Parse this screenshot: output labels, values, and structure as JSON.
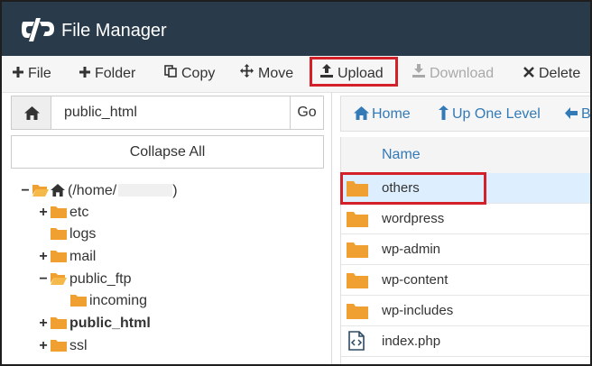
{
  "app": {
    "title": "File Manager",
    "logo_icon": "cpanel-logo-icon"
  },
  "toolbar": {
    "file": "File",
    "folder": "Folder",
    "copy": "Copy",
    "move": "Move",
    "upload": "Upload",
    "download": "Download",
    "delete": "Delete"
  },
  "path_bar": {
    "value": "public_html",
    "go": "Go"
  },
  "collapse_all": "Collapse All",
  "tree": {
    "root": "(/home/",
    "root_close": ")",
    "etc": "etc",
    "logs": "logs",
    "mail": "mail",
    "public_ftp": "public_ftp",
    "incoming": "incoming",
    "public_html": "public_html",
    "ssl": "ssl"
  },
  "nav": {
    "home": "Home",
    "up": "Up One Level",
    "back": "B"
  },
  "list": {
    "header": "Name",
    "rows": [
      "others",
      "wordpress",
      "wp-admin",
      "wp-content",
      "wp-includes",
      "index.php"
    ]
  },
  "colors": {
    "header_bg": "#293a4a",
    "folder": "#f0a030",
    "link": "#337ab7",
    "highlight_border": "#d32029",
    "selected_row": "#ddeeff"
  }
}
